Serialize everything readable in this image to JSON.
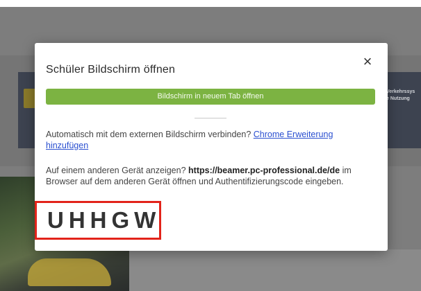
{
  "background": {
    "right_text_line1": "Verkehrssys",
    "right_text_line2": "e Nutzung"
  },
  "modal": {
    "title": "Schüler Bildschirm öffnen",
    "close_icon": "×",
    "open_tab_button": "Bildschirm in neuem Tab öffnen",
    "auto_connect_text": "Automatisch mit dem externen Bildschirm verbinden?",
    "auto_connect_link": "Chrome Erweiterung hinzufügen",
    "other_device_prefix": "Auf einem anderen Gerät anzeigen?",
    "other_device_url": "https://beamer.pc-professional.de/de",
    "other_device_suffix": "im Browser auf dem anderen Gerät öffnen und Authentifizierungscode eingeben.",
    "auth_code": "UHHGW"
  },
  "colors": {
    "accent_green": "#7cb342",
    "link_blue": "#2a4fd0",
    "highlight_red": "#e2231a"
  }
}
